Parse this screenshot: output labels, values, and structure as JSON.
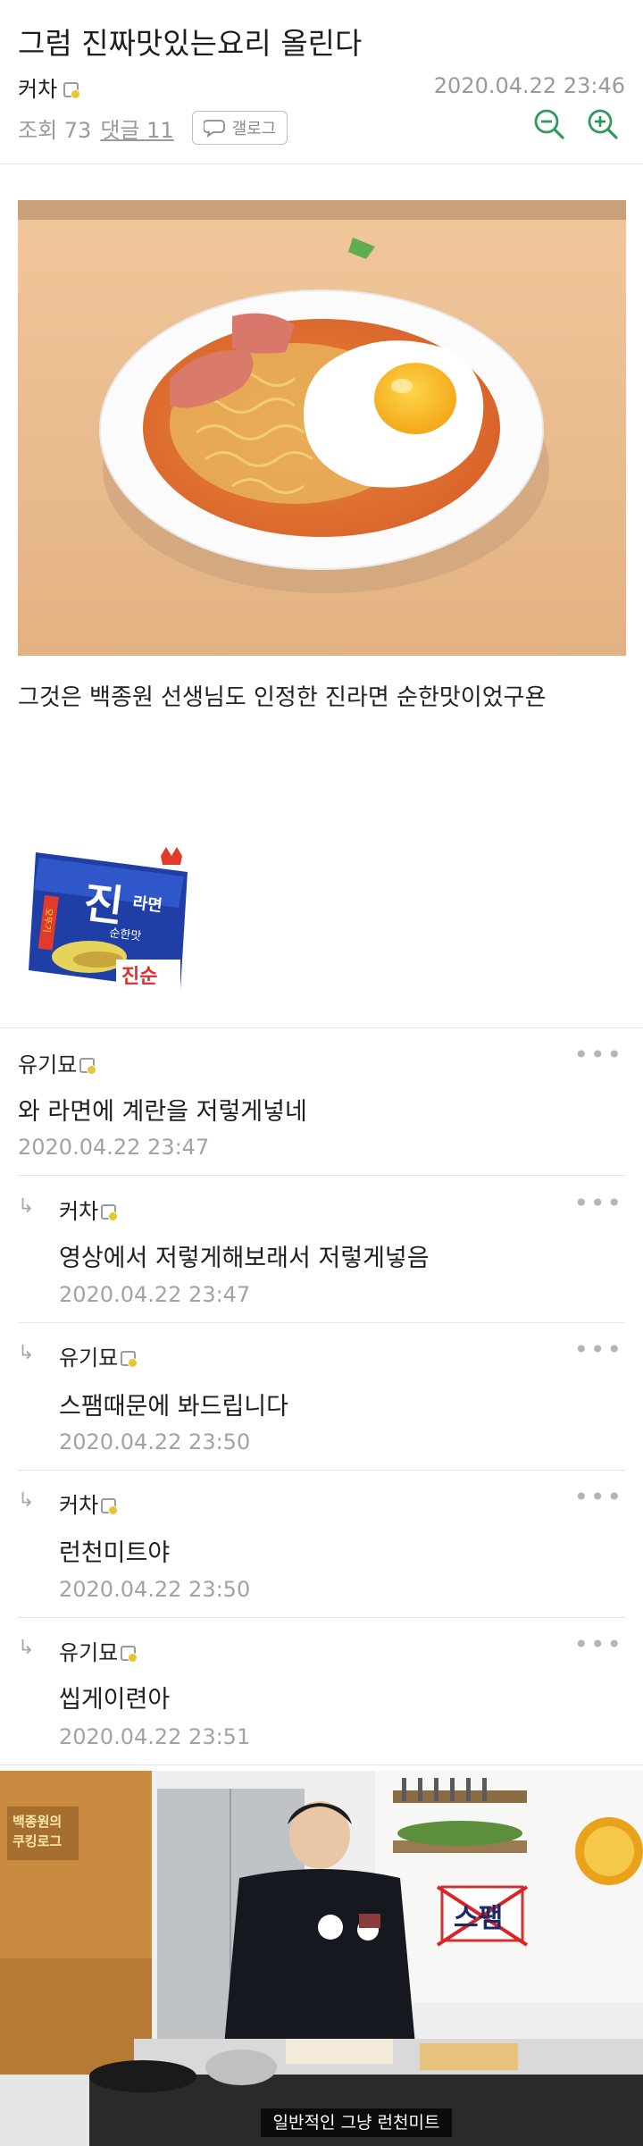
{
  "post": {
    "title": "그럼 진짜맛있는요리 올린다",
    "author": "커차",
    "datetime": "2020.04.22 23:46",
    "views_label": "조회 73",
    "comments_label": "댓글 11",
    "gallog_label": "갤로그",
    "body_text": "그것은 백종원 선생님도 인정한 진라면 순한맛이었구욘"
  },
  "ramen_package": {
    "brand_big": "진",
    "brand_sub": "라면",
    "flavor": "순한맛",
    "flavor_mark": "진순",
    "side_text": "오뚜기"
  },
  "comments": [
    {
      "author": "유기묘",
      "text": "와 라면에 계란을 저렇게넣네",
      "date": "2020.04.22 23:47",
      "reply": false
    },
    {
      "author": "커차",
      "text": "영상에서 저렇게해보래서 저렇게넣음",
      "date": "2020.04.22 23:47",
      "reply": true
    },
    {
      "author": "유기묘",
      "text": "스팸때문에 봐드립니다",
      "date": "2020.04.22 23:50",
      "reply": true
    },
    {
      "author": "커차",
      "text": "런천미트야",
      "date": "2020.04.22 23:50",
      "reply": true
    },
    {
      "author": "유기묘",
      "text": "씹게이련아",
      "date": "2020.04.22 23:51",
      "reply": true
    }
  ],
  "more_icon": "more-dots-icon",
  "video": {
    "logo_line1": "백종원의",
    "logo_line2": "쿠킹로그",
    "sticker": "스팸",
    "caption": "일반적인 그냥 런천미트"
  },
  "colors": {
    "zoom_icon": "#2f9a5a",
    "level_badge": "#e7c531",
    "muted_text": "#9a9a9a"
  }
}
